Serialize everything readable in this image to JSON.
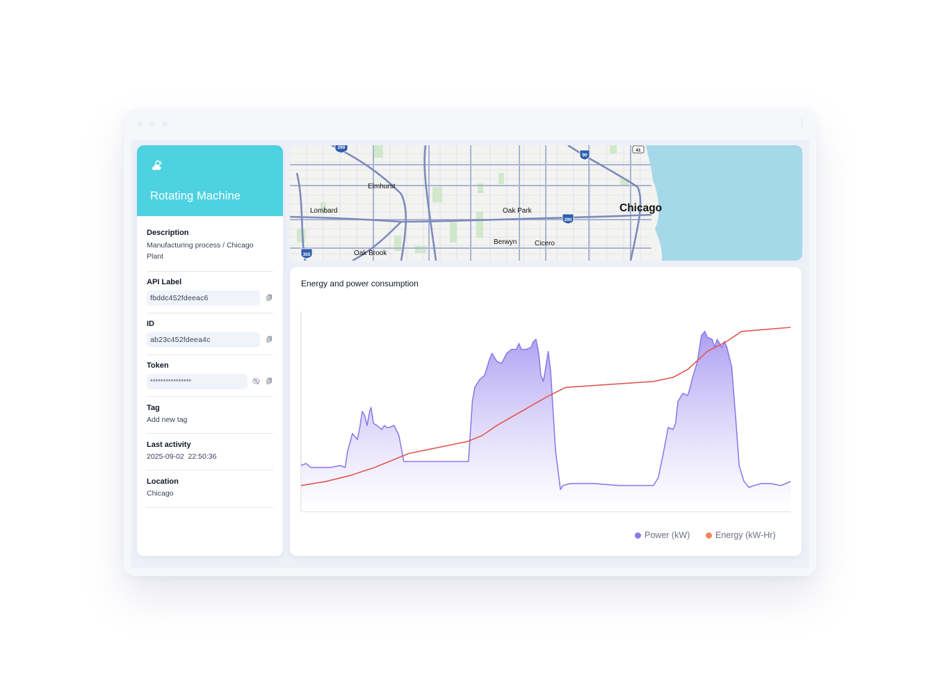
{
  "device": {
    "name": "Rotating Machine",
    "icon": "cloud-sun-icon"
  },
  "fields": {
    "description": {
      "label": "Description",
      "value": "Manufacturing process / Chicago Plant"
    },
    "api_label": {
      "label": "API Label",
      "value": "fbddc452fdeeac6"
    },
    "id": {
      "label": "ID",
      "value": "ab23c452fdeea4c"
    },
    "token": {
      "label": "Token",
      "value": "****************"
    },
    "tag": {
      "label": "Tag",
      "value": "Add new tag"
    },
    "last_activity": {
      "label": "Last activity",
      "value": "2025-09-02  22:50:36"
    },
    "location": {
      "label": "Location",
      "value": "Chicago"
    }
  },
  "map": {
    "labels": {
      "elmhurst": "Elmhurst",
      "lombard": "Lombard",
      "oak_park": "Oak Park",
      "chicago": "Chicago",
      "berwyn": "Berwyn",
      "cicero": "Cicero",
      "oak_brook": "Oak Brook"
    },
    "shields": {
      "i290_top": "290",
      "i90": "90",
      "i41": "41",
      "i290": "290",
      "i355": "355"
    }
  },
  "chart": {
    "title": "Energy and power consumption",
    "legend": {
      "power": "Power (kW)",
      "energy": "Energy (kW-Hr)"
    },
    "colors": {
      "power": "#8c7be9",
      "energy": "#e0564f",
      "legend_energy": "#f2845c"
    }
  },
  "chart_data": {
    "type": "area",
    "title": "Energy and power consumption",
    "xlabel": "",
    "ylabel": "",
    "x_range": [
      0,
      100
    ],
    "y_range": [
      0,
      100
    ],
    "grid": false,
    "legend_position": "bottom-right",
    "series": [
      {
        "name": "Power (kW)",
        "type": "area",
        "points": [
          [
            0,
            23
          ],
          [
            1,
            24
          ],
          [
            2,
            22
          ],
          [
            4,
            22
          ],
          [
            6,
            22
          ],
          [
            8,
            23
          ],
          [
            9,
            22
          ],
          [
            9.5,
            30
          ],
          [
            10.5,
            39
          ],
          [
            11.5,
            36
          ],
          [
            12,
            42
          ],
          [
            12.5,
            50
          ],
          [
            13,
            48
          ],
          [
            13.5,
            43
          ],
          [
            14,
            50
          ],
          [
            14.3,
            52
          ],
          [
            14.8,
            44
          ],
          [
            15.5,
            43
          ],
          [
            16,
            42
          ],
          [
            16.5,
            41
          ],
          [
            17,
            43
          ],
          [
            17.5,
            42
          ],
          [
            18,
            42
          ],
          [
            19,
            43
          ],
          [
            20,
            38
          ],
          [
            21,
            25
          ],
          [
            22,
            25
          ],
          [
            24,
            25
          ],
          [
            26,
            25
          ],
          [
            28,
            25
          ],
          [
            31,
            25
          ],
          [
            33,
            25
          ],
          [
            34.2,
            25
          ],
          [
            35,
            55
          ],
          [
            35.5,
            62
          ],
          [
            36.5,
            66
          ],
          [
            37.5,
            68
          ],
          [
            38.5,
            76
          ],
          [
            39,
            79
          ],
          [
            39.5,
            77
          ],
          [
            40,
            75
          ],
          [
            41,
            74
          ],
          [
            42,
            79
          ],
          [
            43,
            81
          ],
          [
            44,
            81
          ],
          [
            44.5,
            84
          ],
          [
            45,
            81
          ],
          [
            46,
            81
          ],
          [
            47,
            82
          ],
          [
            47.5,
            85
          ],
          [
            48,
            86
          ],
          [
            48.5,
            80
          ],
          [
            49,
            68
          ],
          [
            49.5,
            65
          ],
          [
            50,
            72
          ],
          [
            50.5,
            80
          ],
          [
            51,
            70
          ],
          [
            52,
            30
          ],
          [
            53,
            11
          ],
          [
            53.5,
            13
          ],
          [
            55,
            14
          ],
          [
            60,
            14
          ],
          [
            65,
            13
          ],
          [
            72,
            13
          ],
          [
            73,
            17
          ],
          [
            74,
            29
          ],
          [
            75,
            42
          ],
          [
            76,
            41
          ],
          [
            76.5,
            44
          ],
          [
            77,
            55
          ],
          [
            78,
            59
          ],
          [
            79,
            58
          ],
          [
            79.5,
            62
          ],
          [
            80,
            67
          ],
          [
            80.5,
            71
          ],
          [
            81,
            75
          ],
          [
            81.8,
            88
          ],
          [
            82.5,
            90
          ],
          [
            83,
            87
          ],
          [
            84,
            86
          ],
          [
            84.5,
            82
          ],
          [
            85,
            86
          ],
          [
            85.5,
            84
          ],
          [
            86,
            82
          ],
          [
            86.5,
            85
          ],
          [
            87,
            82
          ],
          [
            88,
            72
          ],
          [
            89,
            40
          ],
          [
            89.5,
            23
          ],
          [
            90.5,
            15
          ],
          [
            91.5,
            12
          ],
          [
            92.5,
            13
          ],
          [
            94,
            14
          ],
          [
            96,
            14
          ],
          [
            98,
            13
          ],
          [
            99,
            14
          ],
          [
            100,
            15
          ]
        ]
      },
      {
        "name": "Energy (kW-Hr)",
        "type": "line",
        "points": [
          [
            0,
            13
          ],
          [
            5,
            15
          ],
          [
            10,
            18
          ],
          [
            15,
            22
          ],
          [
            19,
            26
          ],
          [
            22,
            29
          ],
          [
            26,
            31
          ],
          [
            30,
            33
          ],
          [
            34,
            35
          ],
          [
            37,
            38
          ],
          [
            40,
            43
          ],
          [
            45,
            50
          ],
          [
            50,
            57
          ],
          [
            54,
            62
          ],
          [
            60,
            63
          ],
          [
            66,
            64
          ],
          [
            72,
            65
          ],
          [
            76,
            67
          ],
          [
            79,
            71
          ],
          [
            83,
            80
          ],
          [
            87,
            85
          ],
          [
            90,
            90
          ],
          [
            95,
            91
          ],
          [
            100,
            92
          ]
        ]
      }
    ]
  }
}
